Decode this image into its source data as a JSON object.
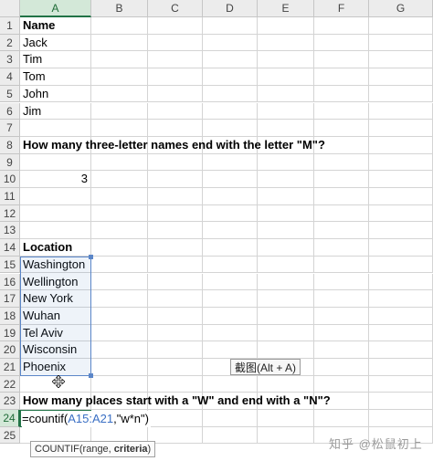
{
  "columns": [
    "A",
    "B",
    "C",
    "D",
    "E",
    "F",
    "G"
  ],
  "rows": [
    1,
    2,
    3,
    4,
    5,
    6,
    7,
    8,
    9,
    10,
    11,
    12,
    13,
    14,
    15,
    16,
    17,
    18,
    19,
    20,
    21,
    22,
    23,
    24,
    25
  ],
  "active_column": "A",
  "active_row": 24,
  "cells": {
    "A1": "Name",
    "A2": "Jack",
    "A3": "Tim",
    "A4": "Tom",
    "A5": "John",
    "A6": "Jim",
    "A8": "How many three-letter names end with the letter \"M\"?",
    "A10": "3",
    "A14": "Location",
    "A15": "Washington",
    "A16": "Wellington",
    "A17": "New York",
    "A18": "Wuhan",
    "A19": "Tel Aviv",
    "A20": "Wisconsin",
    "A21": "Phoenix",
    "A23": "How many places start with a \"W\" and end with a \"N\"?"
  },
  "editing": {
    "cell": "A24",
    "formula_prefix": "=countif(",
    "formula_range": "A15:A21",
    "formula_suffix": ",\"w*n\")"
  },
  "selected_range": "A15:A21",
  "function_hint": {
    "name": "COUNTIF(range, ",
    "current_arg": "criteria",
    "close": ")"
  },
  "screenshot_tooltip": "截图(Alt + A)",
  "watermark": "知乎 @松鼠初上",
  "colors": {
    "header_bg": "#ececec",
    "active_header_bg": "#d3e8d8",
    "excel_green": "#217346",
    "range_blue": "#5b86c8"
  }
}
